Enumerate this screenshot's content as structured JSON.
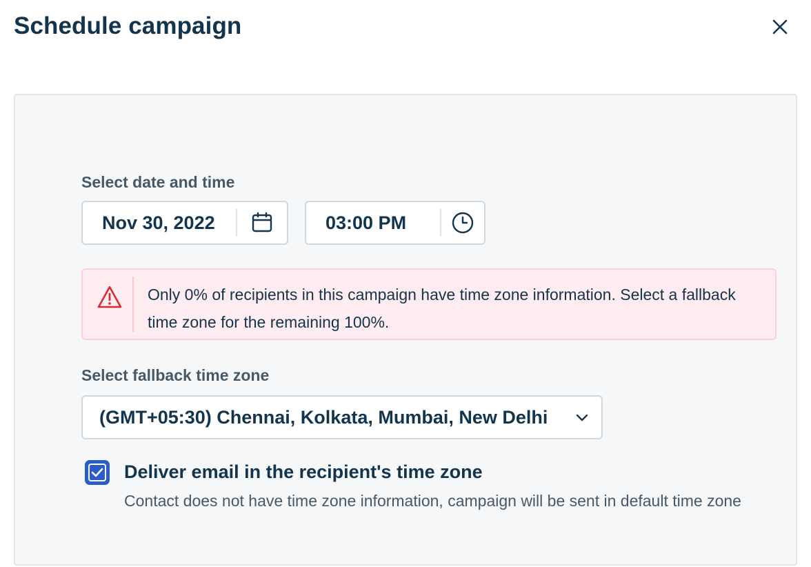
{
  "dialog": {
    "title": "Schedule campaign",
    "close_icon": "close-icon"
  },
  "schedule": {
    "date_time_label": "Select date and time",
    "date_value": "Nov 30, 2022",
    "date_icon": "calendar-icon",
    "time_value": "03:00 PM",
    "time_icon": "clock-icon"
  },
  "alert": {
    "icon": "warning-icon",
    "text": "Only 0% of recipients in this campaign have time zone information. Select a fallback time zone for the remaining 100%.",
    "color": "#ffecf0",
    "icon_color": "#d72d30"
  },
  "fallback": {
    "label": "Select fallback time zone",
    "selected": "(GMT+05:30) Chennai, Kolkata, Mumbai, New Delhi",
    "chevron_icon": "chevron-down-icon"
  },
  "deliver": {
    "checked": true,
    "label": "Deliver email in the recipient's time zone",
    "help": "Contact does not have time zone information, campaign will be sent in default time zone",
    "accent": "#2c5cc5"
  }
}
